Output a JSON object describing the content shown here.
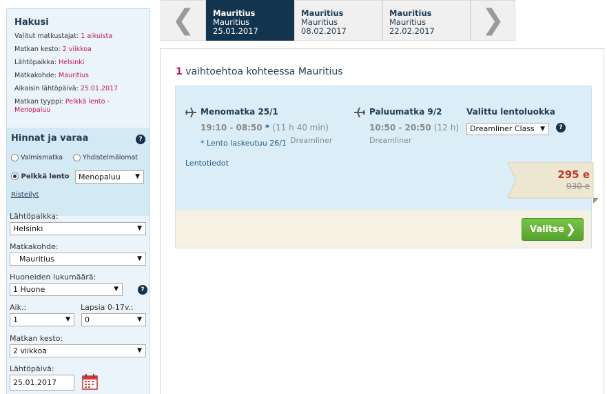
{
  "summary": {
    "title": "Hakusi",
    "rows": [
      {
        "label": "Valitut matkustajat:",
        "value": "1 aikuista"
      },
      {
        "label": "Matkan kesto:",
        "value": "2 viikkoa"
      },
      {
        "label": "Lähtöpaikka:",
        "value": "Helsinki"
      },
      {
        "label": "Matkakohde:",
        "value": "Mauritius"
      },
      {
        "label": "Aikaisin lähtöpäivä:",
        "value": "25.01.2017"
      },
      {
        "label": "Matkan tyyppi:",
        "value": "Pelkkä lento -"
      },
      {
        "label": "",
        "value": "Menopaluu"
      }
    ]
  },
  "booking": {
    "title": "Hinnat ja varaa",
    "help": "?",
    "types": [
      "Valmismatka",
      "Yhdistelmälomat",
      "Pelkkä lento"
    ],
    "trip_select": "Menopaluu",
    "cruise_link": "Risteilyt"
  },
  "form": {
    "departure_label": "Lähtöpaikka:",
    "departure_value": "Helsinki",
    "destination_label": "Matkakohde:",
    "destination_value": "Mauritius",
    "rooms_label": "Huoneiden lukumäärä:",
    "rooms_value": "1 Huone",
    "adults_label": "Aik.:",
    "adults_value": "1",
    "children_label": "Lapsia 0-17v.:",
    "children_value": "0",
    "duration_label": "Matkan kesto:",
    "duration_value": "2 viikkoa",
    "date_label": "Lähtöpäivä:",
    "date_value": "25.01.2017"
  },
  "tabs": [
    {
      "name": "Mauritius",
      "line2": "Mauritius",
      "date": "25.01.2017",
      "active": true
    },
    {
      "name": "Mauritius",
      "line2": "Mauritius",
      "date": "08.02.2017",
      "active": false
    },
    {
      "name": "Mauritius",
      "line2": "Mauritius",
      "date": "22.02.2017",
      "active": false
    }
  ],
  "results": {
    "count": "1",
    "text": "vaihtoehtoa kohteessa Mauritius"
  },
  "flight": {
    "outbound_title": "Menomatka 25/1",
    "outbound_time": "19:10 - 08:50",
    "outbound_star": "*",
    "outbound_duration": "(11 h 40 min)",
    "outbound_aircraft": "Dreamliner",
    "outbound_note": "* Lento laskeutuu 26/1",
    "return_title": "Paluumatka 9/2",
    "return_time": "10:50 - 20:50",
    "return_duration": "(12 h)",
    "return_aircraft": "Dreamliner",
    "class_title": "Valittu lentoluokka",
    "class_value": "Dreamliner Class",
    "info_link": "Lentotiedot"
  },
  "price": {
    "current": "295 e",
    "old": "930 e"
  },
  "select_label": "Valitse"
}
